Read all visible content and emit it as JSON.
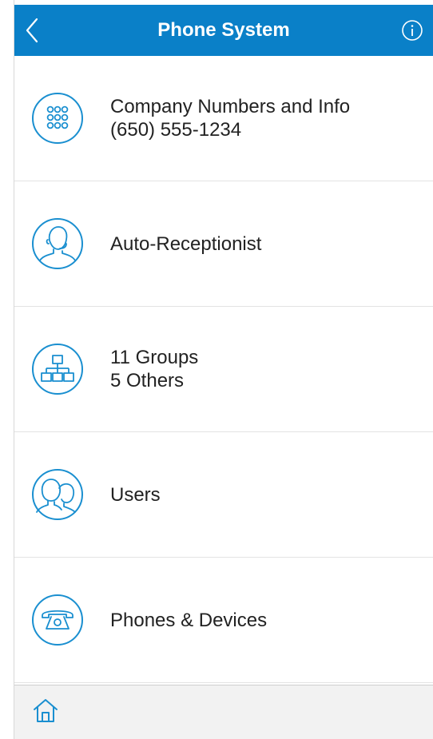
{
  "header": {
    "title": "Phone System",
    "back_icon": "chevron-left-icon",
    "info_icon": "info-icon",
    "background_color": "#0a80c8"
  },
  "items": [
    {
      "icon": "dialpad-icon",
      "line1": "Company Numbers and Info",
      "line2": "(650) 555-1234"
    },
    {
      "icon": "receptionist-headset-icon",
      "line1": "Auto-Receptionist",
      "line2": ""
    },
    {
      "icon": "org-chart-icon",
      "line1": "11 Groups",
      "line2": "5 Others"
    },
    {
      "icon": "users-icon",
      "line1": "Users",
      "line2": ""
    },
    {
      "icon": "desk-phone-icon",
      "line1": "Phones & Devices",
      "line2": ""
    }
  ],
  "footer": {
    "home_icon": "home-icon"
  },
  "colors": {
    "accent": "#1a8fd0",
    "text": "#222222",
    "divider": "#e3e3e3",
    "footer_bg": "#f2f2f2"
  }
}
